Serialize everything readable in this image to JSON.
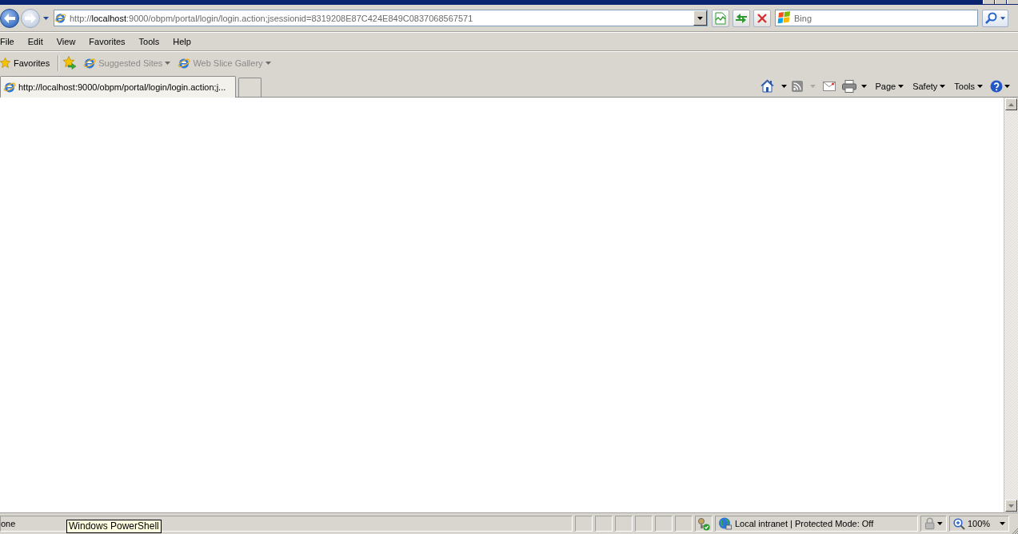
{
  "back_button": {
    "disabled": false
  },
  "forward_button": {
    "disabled": true
  },
  "address_bar": {
    "url": "http://**localhost**:9000/obpm/portal/login/login.action;jsessionid=8319208E87C424E849C0837068567571"
  },
  "search": {
    "placeholder": "Bing"
  },
  "menu": [
    "File",
    "Edit",
    "View",
    "Favorites",
    "Tools",
    "Help"
  ],
  "favorites_bar": {
    "label": "Favorites",
    "items": [
      {
        "label": "Suggested Sites",
        "disabled": true
      },
      {
        "label": "Web Slice Gallery",
        "disabled": true
      }
    ]
  },
  "tabs": [
    {
      "label": "http://localhost:9000/obpm/portal/login/login.action;j...",
      "selected": true
    }
  ],
  "command_bar": {
    "feeds": {
      "disabled": true
    },
    "menus": [
      "Page",
      "Safety",
      "Tools"
    ]
  },
  "status_bar": {
    "text": "one",
    "zone": "Local intranet | Protected Mode: Off",
    "zoom": "100%"
  },
  "tooltip": {
    "text": "Windows PowerShell"
  }
}
